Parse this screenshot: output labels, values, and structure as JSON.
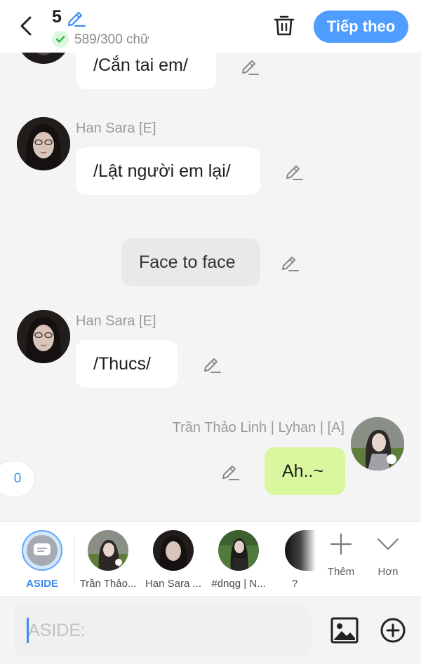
{
  "header": {
    "chapter_number": "5",
    "word_count": "589/300 chữ",
    "next_label": "Tiếp theo"
  },
  "messages": [
    {
      "text": "/Cắn tai em/"
    },
    {
      "sender": "Han Sara [E]",
      "text": "/Lật người em lại/"
    },
    {
      "text": "Face to face"
    },
    {
      "sender": "Han Sara [E]",
      "text": "/Thucs/"
    },
    {
      "sender": "Trần Thảo Linh | Lyhan | [A]",
      "text": "Ah..~"
    }
  ],
  "counter": "0",
  "characters": [
    {
      "name": "ASIDE"
    },
    {
      "name": "Trần Thảo..."
    },
    {
      "name": "Han Sara ..."
    },
    {
      "name": "#dnqg | N..."
    },
    {
      "name": "?"
    }
  ],
  "bar_actions": {
    "more_label": "Thêm",
    "expand_label": "Hơn"
  },
  "input": {
    "placeholder": "ASIDE:"
  },
  "colors": {
    "accent": "#4f9dff",
    "my_bubble": "#d9f79f",
    "narration_bubble": "#e9e9ea"
  }
}
